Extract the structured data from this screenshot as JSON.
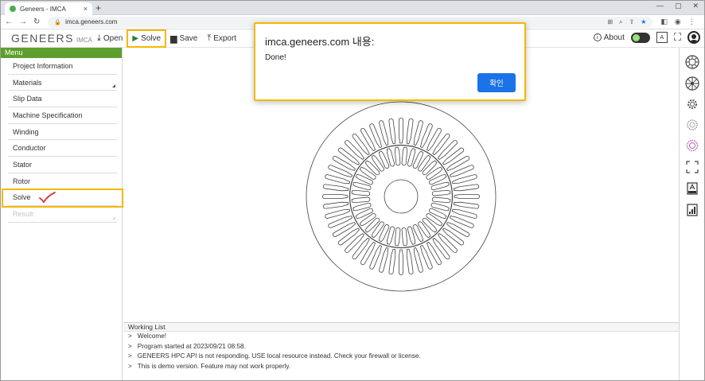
{
  "browser": {
    "tab_title": "Geneers - IMCA",
    "tab_close": "×",
    "new_tab": "+",
    "url": "imca.geneers.com",
    "win_minimize": "—",
    "win_restore": "▢",
    "win_close": "✕"
  },
  "toolbar": {
    "logo_text": "GENEERS",
    "logo_sub": "IMCA",
    "open_label": "Open",
    "solve_label": "Solve",
    "save_label": "Save",
    "export_label": "Export",
    "about_label": "About"
  },
  "sidebar": {
    "header": "Menu",
    "items": [
      {
        "label": "Project Information"
      },
      {
        "label": "Materials"
      },
      {
        "label": "Slip Data"
      },
      {
        "label": "Machine Specification"
      },
      {
        "label": "Winding"
      },
      {
        "label": "Conductor"
      },
      {
        "label": "Stator"
      },
      {
        "label": "Rotor"
      },
      {
        "label": "Solve"
      },
      {
        "label": "Result"
      }
    ]
  },
  "working_list": {
    "title": "Working List",
    "prompt": ">",
    "lines": [
      "Welcome!",
      "Program started at 2023/09/21 08:58.",
      "GENEERS HPC API is not responding. USE local resource instead. Check your firewall or license.",
      "This is demo version. Feature may not work properly."
    ]
  },
  "dialog": {
    "title": "imca.geneers.com 내용:",
    "message": "Done!",
    "ok_label": "확인"
  },
  "colors": {
    "accent_highlight": "#f5b800",
    "menu_green": "#5e9e2e",
    "dialog_button": "#1a73e8"
  }
}
